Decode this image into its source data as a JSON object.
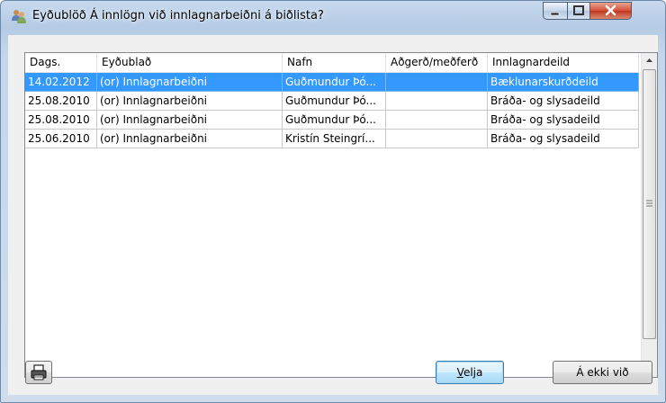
{
  "window": {
    "title": "Eyðublöð  Á innlögn við innlagnarbeiðni á biðlista?"
  },
  "table": {
    "columns": [
      "Dags.",
      "Eyðublað",
      "Nafn",
      "Aðgerð/meðferð",
      "Innlagnardeild"
    ],
    "rows": [
      {
        "date": "14.02.2012",
        "form": "(or) Innlagnarbeiðni",
        "name": "Guðmundur Þó...",
        "procedure": "",
        "ward": "Bæklunarskurðdeild",
        "selected": true
      },
      {
        "date": "25.08.2010",
        "form": "(or) Innlagnarbeiðni",
        "name": "Guðmundur Þó...",
        "procedure": "",
        "ward": "Bráða- og slysadeild",
        "selected": false
      },
      {
        "date": "25.08.2010",
        "form": "(or) Innlagnarbeiðni",
        "name": "Guðmundur Þó...",
        "procedure": "",
        "ward": "Bráða- og slysadeild",
        "selected": false
      },
      {
        "date": "25.06.2010",
        "form": "(or) Innlagnarbeiðni",
        "name": "Kristín Steingrí...",
        "procedure": "",
        "ward": "Bráða- og slysadeild",
        "selected": false
      }
    ]
  },
  "buttons": {
    "print_icon": "printer-icon",
    "ok_mnemonic": "V",
    "ok_rest": "elja",
    "cancel": "Á ekki við"
  },
  "colors": {
    "selection": "#3399ff",
    "close_button": "#c2351d"
  }
}
